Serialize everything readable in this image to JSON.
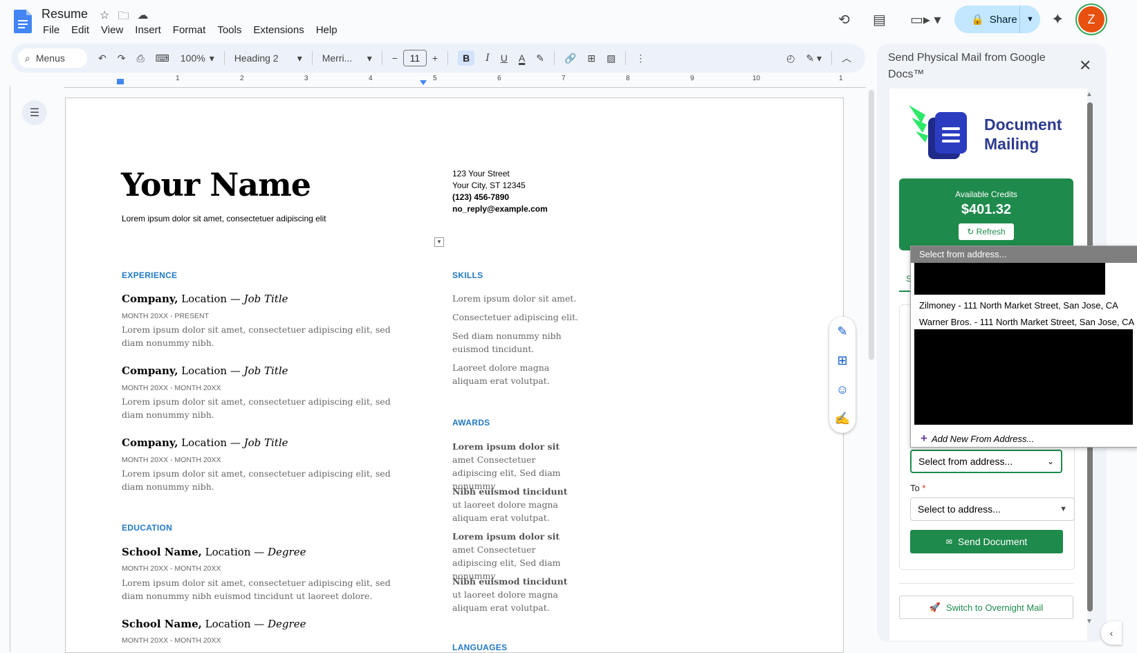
{
  "doc": {
    "title": "Resume",
    "menu": [
      "File",
      "Edit",
      "View",
      "Insert",
      "Format",
      "Tools",
      "Extensions",
      "Help"
    ],
    "share_label": "Share",
    "avatar_initial": "Z"
  },
  "toolbar": {
    "search_label": "Menus",
    "zoom": "100%",
    "style": "Heading 2",
    "font": "Merri...",
    "font_size": "11",
    "bold": "B",
    "italic": "I",
    "underline": "U",
    "text_color": "A"
  },
  "ruler": {
    "labels": [
      "1",
      "2",
      "3",
      "4",
      "5",
      "6",
      "7",
      "8",
      "9",
      "10",
      "1"
    ]
  },
  "resume": {
    "name": "Your Name",
    "tagline": "Lorem ipsum dolor sit amet, consectetuer adipiscing elit",
    "contact": {
      "street": "123 Your Street",
      "city": "Your City, ST 12345",
      "phone": "(123) 456-7890",
      "email": "no_reply@example.com"
    },
    "experience_heading": "EXPERIENCE",
    "jobs": [
      {
        "company": "Company,",
        "rest": " Location — ",
        "title": "Job Title",
        "dates": "MONTH 20XX - PRESENT",
        "desc": "Lorem ipsum dolor sit amet, consectetuer adipiscing elit, sed diam nonummy nibh."
      },
      {
        "company": "Company,",
        "rest": " Location — ",
        "title": "Job Title",
        "dates": "MONTH 20XX - MONTH 20XX",
        "desc": "Lorem ipsum dolor sit amet, consectetuer adipiscing elit, sed diam nonummy nibh."
      },
      {
        "company": "Company,",
        "rest": " Location — ",
        "title": "Job Title",
        "dates": "MONTH 20XX - MONTH 20XX",
        "desc": "Lorem ipsum dolor sit amet, consectetuer adipiscing elit, sed diam nonummy nibh."
      }
    ],
    "education_heading": "EDUCATION",
    "schools": [
      {
        "school": "School Name,",
        "rest": " Location — ",
        "degree": "Degree",
        "dates": "MONTH 20XX - MONTH 20XX",
        "desc": "Lorem ipsum dolor sit amet, consectetuer adipiscing elit, sed diam nonummy nibh euismod tincidunt ut laoreet dolore."
      },
      {
        "school": "School Name,",
        "rest": " Location — ",
        "degree": "Degree",
        "dates": "MONTH 20XX - MONTH 20XX"
      }
    ],
    "skills_heading": "SKILLS",
    "skills": [
      "Lorem ipsum dolor sit amet.",
      "Consectetuer adipiscing elit.",
      "Sed diam nonummy nibh euismod tincidunt.",
      "Laoreet dolore magna aliquam erat volutpat."
    ],
    "awards_heading": "AWARDS",
    "awards": [
      {
        "bold": "Lorem ipsum dolor sit",
        "rest": " amet Consectetuer adipiscing elit, Sed diam nonummy"
      },
      {
        "bold": "Nibh euismod tincidunt",
        "rest": " ut laoreet dolore magna aliquam erat volutpat."
      },
      {
        "bold": "Lorem ipsum dolor sit",
        "rest": " amet Consectetuer adipiscing elit, Sed diam nonummy"
      },
      {
        "bold": "Nibh euismod tincidunt",
        "rest": " ut laoreet dolore magna aliquam erat volutpat."
      }
    ],
    "languages_heading": "LANGUAGES"
  },
  "panel": {
    "title": "Send Physical Mail from Google Docs™",
    "brand_line1": "Document",
    "brand_line2": "Mailing",
    "credits_label": "Available Credits",
    "credits_value": "$401.32",
    "refresh_label": "↻ Refresh",
    "from_select": "Select from address...",
    "to_label": "To",
    "to_required": "*",
    "to_select": "Select to address...",
    "send_label": "Send Document",
    "overnight_label": "Switch to Overnight Mail"
  },
  "dropdown": {
    "header": "Select from address...",
    "options": [
      "Zilmoney - 111 North Market Street, San Jose, CA",
      "Warner Bros. - 111 North Market Street, San Jose, CA"
    ],
    "add_label": "Add New From Address..."
  },
  "colors": {
    "accent_green": "#1e8a4c",
    "docs_blue": "#2079c7",
    "share_bg": "#c2e7ff",
    "brand_navy": "#2d3b8f"
  }
}
